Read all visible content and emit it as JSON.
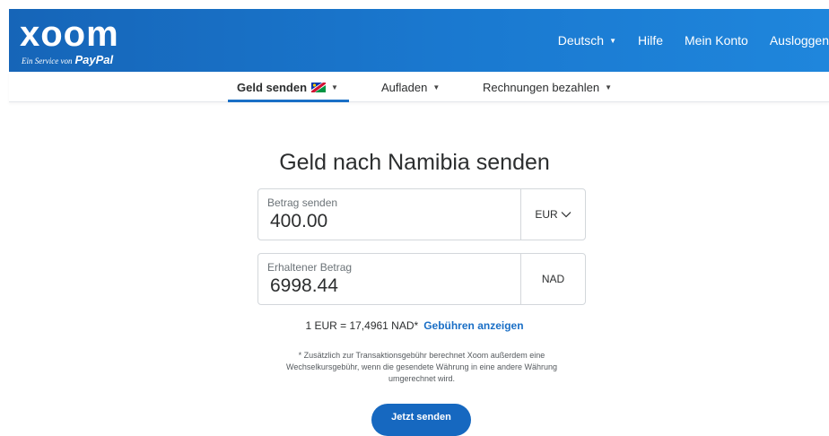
{
  "header": {
    "logo_text": "xoom",
    "logo_service": "Ein Service von",
    "logo_paypal": "PayPal",
    "nav": [
      {
        "label": "Deutsch"
      },
      {
        "label": "Hilfe"
      },
      {
        "label": "Mein Konto"
      },
      {
        "label": "Ausloggen"
      }
    ]
  },
  "subnav": {
    "items": [
      {
        "label": "Geld senden",
        "active": true
      },
      {
        "label": "Aufladen"
      },
      {
        "label": "Rechnungen bezahlen"
      }
    ]
  },
  "main": {
    "title": "Geld nach Namibia senden",
    "send_field": {
      "label": "Betrag senden",
      "value": "400.00",
      "currency": "EUR"
    },
    "receive_field": {
      "label": "Erhaltener Betrag",
      "value": "6998.44",
      "currency": "NAD"
    },
    "rate_text": "1 EUR = 17,4961 NAD*",
    "fees_link": "Gebühren anzeigen",
    "footnote": "* Zusätzlich zur Transaktionsgebühr berechnet Xoom außerdem eine Wechselkursgebühr, wenn die gesendete Währung in eine andere Währung umgerechnet wird.",
    "send_button": "Jetzt senden"
  },
  "colors": {
    "header_blue": "#1a79d0",
    "accent_blue": "#1a6fc6",
    "button_blue": "#1668c0"
  },
  "icons": [
    "caret-down-icon",
    "namibia-flag-icon",
    "chevron-down-icon"
  ]
}
